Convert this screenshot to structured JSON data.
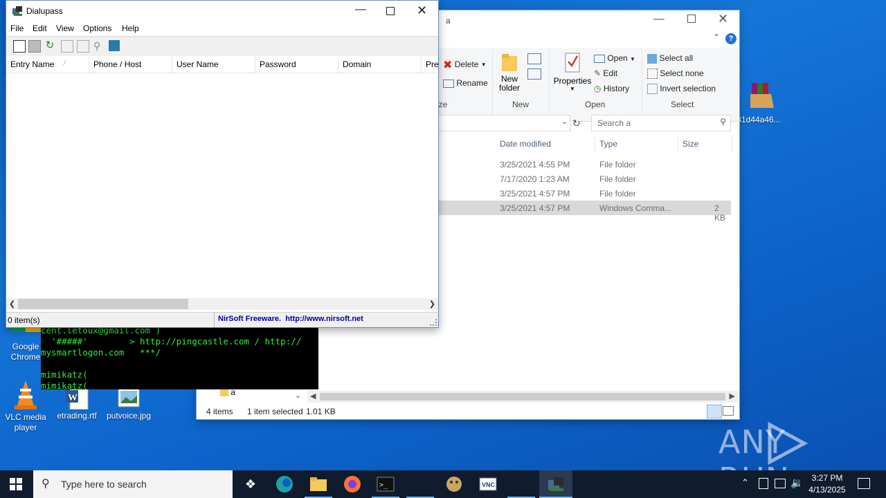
{
  "desktop": {
    "icons": [
      {
        "label": "Google Chrome"
      },
      {
        "label": "VLC media player"
      },
      {
        "label": "etrading.rtf"
      },
      {
        "label": "putvoice.jpg"
      },
      {
        "label": "31d44a46..."
      }
    ],
    "watermark": "ANY RUN"
  },
  "explorer": {
    "title": "a",
    "ribbon": {
      "delete_label": "Delete",
      "rename_label": "Rename",
      "organize_group": "ize",
      "new_folder_label_1": "New",
      "new_folder_label_2": "folder",
      "new_group": "New",
      "properties_label": "Properties",
      "open_label": "Open",
      "edit_label": "Edit",
      "history_label": "History",
      "open_group": "Open",
      "select_all": "Select all",
      "select_none": "Select none",
      "invert_selection": "Invert selection",
      "select_group": "Select"
    },
    "search_placeholder": "Search a",
    "columns": {
      "date": "Date modified",
      "type": "Type",
      "size": "Size"
    },
    "rows": [
      {
        "date": "3/25/2021 4:55 PM",
        "type": "File folder",
        "size": ""
      },
      {
        "date": "7/17/2020 1:23 AM",
        "type": "File folder",
        "size": ""
      },
      {
        "date": "3/25/2021 4:57 PM",
        "type": "File folder",
        "size": ""
      },
      {
        "date": "3/25/2021 4:57 PM",
        "type": "Windows Comma...",
        "size": "2 KB"
      }
    ],
    "nav_item": "a",
    "status": {
      "items": "4 items",
      "selected": "1 item selected",
      "size": "1.01 KB"
    }
  },
  "dialupass": {
    "title": "Dialupass",
    "menu": [
      "File",
      "Edit",
      "View",
      "Options",
      "Help"
    ],
    "columns": [
      "Entry Name",
      "Phone / Host",
      "User Name",
      "Password",
      "Domain",
      "Pre"
    ],
    "status_items": "0 item(s)",
    "status_link": "NirSoft Freeware.  http://www.nirsoft.net"
  },
  "console": {
    "lines": [
      "cent.letoux@gmail.com )",
      "  '#####'        > http://pingcastle.com / http://",
      "mysmartlogon.com   ***/",
      "",
      "mimikatz(",
      "mimikatz("
    ]
  },
  "taskbar": {
    "search_placeholder": "Type here to search",
    "time": "3:27 PM",
    "date": "4/13/2025"
  }
}
